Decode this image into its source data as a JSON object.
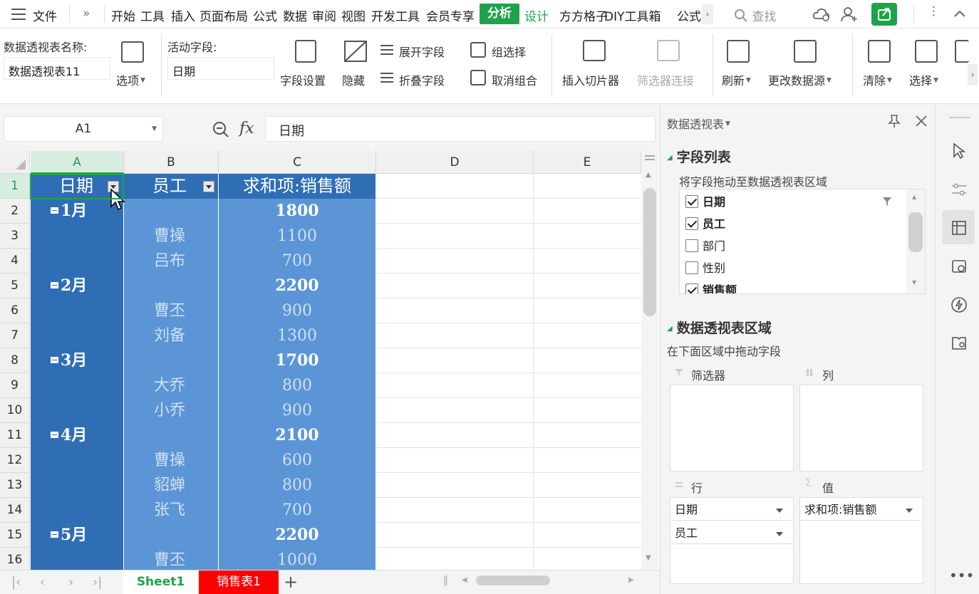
{
  "menubar": {
    "file": "文件",
    "more": "»",
    "tabs": [
      "开始",
      "工具",
      "插入",
      "页面布局",
      "公式",
      "数据",
      "审阅",
      "视图",
      "开发工具",
      "会员专享"
    ],
    "active_tab": "分析",
    "design_tab": "设计",
    "extra_tabs": [
      "方方格子",
      "DIY工具箱",
      "公式"
    ],
    "search": "查找"
  },
  "ribbon": {
    "pivot_name_label": "数据透视表名称:",
    "pivot_name_value": "数据透视表11",
    "options": "选项",
    "active_field_label": "活动字段:",
    "active_field_value": "日期",
    "field_settings": "字段设置",
    "hide": "隐藏",
    "expand_field": "展开字段",
    "collapse_field": "折叠字段",
    "group_selection": "组选择",
    "ungroup": "取消组合",
    "insert_slicer": "插入切片器",
    "filter_connections": "筛选器连接",
    "refresh": "刷新",
    "change_source": "更改数据源",
    "clear": "清除",
    "select": "选择"
  },
  "formula": {
    "cell_ref": "A1",
    "fx": "fx",
    "content": "日期"
  },
  "grid": {
    "columns": [
      "A",
      "B",
      "C",
      "D",
      "E"
    ],
    "rows": [
      "1",
      "2",
      "3",
      "4",
      "5",
      "6",
      "7",
      "8",
      "9",
      "10",
      "11",
      "12",
      "13",
      "14",
      "15",
      "16"
    ],
    "headers": {
      "a": "日期",
      "b": "员工",
      "c": "求和项:销售额"
    },
    "data": [
      {
        "month": "1月",
        "emp": "",
        "amt": "1800",
        "total": true
      },
      {
        "month": "",
        "emp": "曹操",
        "amt": "1100",
        "total": false
      },
      {
        "month": "",
        "emp": "吕布",
        "amt": "700",
        "total": false
      },
      {
        "month": "2月",
        "emp": "",
        "amt": "2200",
        "total": true
      },
      {
        "month": "",
        "emp": "曹丕",
        "amt": "900",
        "total": false
      },
      {
        "month": "",
        "emp": "刘备",
        "amt": "1300",
        "total": false
      },
      {
        "month": "3月",
        "emp": "",
        "amt": "1700",
        "total": true
      },
      {
        "month": "",
        "emp": "大乔",
        "amt": "800",
        "total": false
      },
      {
        "month": "",
        "emp": "小乔",
        "amt": "900",
        "total": false
      },
      {
        "month": "4月",
        "emp": "",
        "amt": "2100",
        "total": true
      },
      {
        "month": "",
        "emp": "曹操",
        "amt": "600",
        "total": false
      },
      {
        "month": "",
        "emp": "貂蝉",
        "amt": "800",
        "total": false
      },
      {
        "month": "",
        "emp": "张飞",
        "amt": "700",
        "total": false
      },
      {
        "month": "5月",
        "emp": "",
        "amt": "2200",
        "total": true
      },
      {
        "month": "",
        "emp": "曹丕",
        "amt": "1000",
        "total": false
      }
    ]
  },
  "sheets": {
    "sheet1": "Sheet1",
    "sheet2": "销售表1",
    "add": "+"
  },
  "panel": {
    "title": "数据透视表",
    "field_list_title": "字段列表",
    "field_list_hint": "将字段拖动至数据透视表区域",
    "fields": [
      {
        "name": "日期",
        "checked": true
      },
      {
        "name": "员工",
        "checked": true
      },
      {
        "name": "部门",
        "checked": false
      },
      {
        "name": "性别",
        "checked": false
      },
      {
        "name": "销售额",
        "checked": true
      }
    ],
    "areas_title": "数据透视表区域",
    "areas_hint": "在下面区域中拖动字段",
    "filter_label": "筛选器",
    "columns_label": "列",
    "rows_label": "行",
    "values_label": "值",
    "row_items": [
      "日期",
      "员工"
    ],
    "value_items": [
      "求和项:销售额"
    ]
  },
  "colors": {
    "accent": "#1fa34a",
    "pivot_dark": "#2f6eb5",
    "pivot_light": "#5b95d6",
    "sheet2_tab": "#ff0000"
  }
}
